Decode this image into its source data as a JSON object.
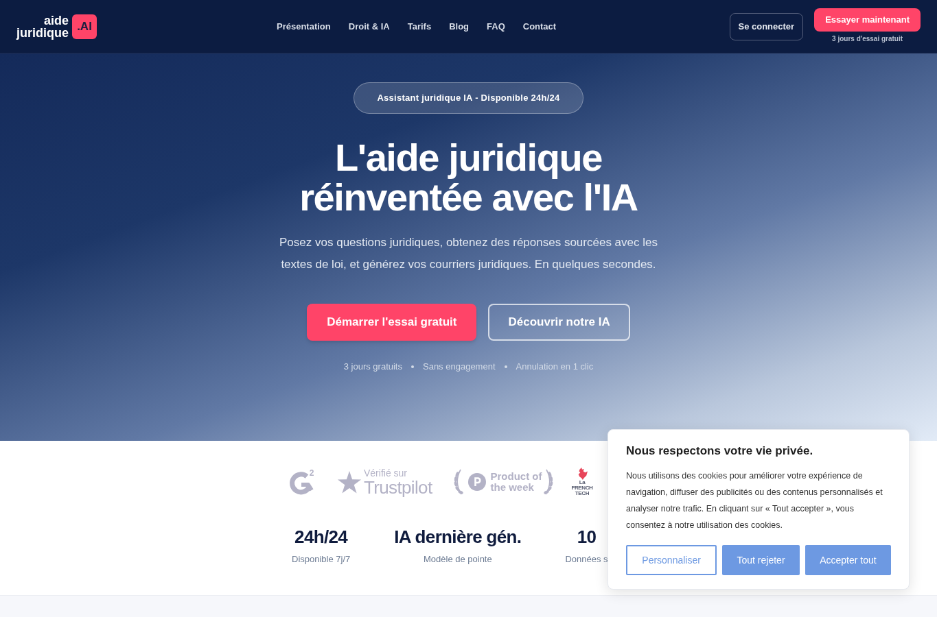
{
  "header": {
    "logo": {
      "line_1": "aide",
      "line_2": "juridique",
      "tile": ".AI"
    },
    "nav": [
      "Présentation",
      "Droit & IA",
      "Tarifs",
      "Blog",
      "FAQ",
      "Contact"
    ],
    "login_button": "Se connecter",
    "cta_button": "Essayer maintenant",
    "cta_note": "3 jours d'essai gratuit"
  },
  "hero": {
    "badge": "Assistant juridique IA - Disponible 24h/24",
    "title_lines": [
      "L'aide juridique",
      "réinventée avec l'IA"
    ],
    "subtitle": "Posez vos questions juridiques, obtenez des réponses sourcées avec les textes de loi, et générez vos courriers juridiques. En quelques secondes.",
    "buttons": [
      {
        "label": "Démarrer l'essai gratuit",
        "kind": "primary"
      },
      {
        "label": "Découvrir notre IA",
        "kind": "outline"
      }
    ],
    "perks": [
      "3 jours gratuits",
      "Sans engagement",
      "Annulation en 1 clic"
    ]
  },
  "trust_logos": [
    {
      "kind": "g2",
      "lines": [
        "2"
      ]
    },
    {
      "kind": "trustpilot",
      "lines": [
        "Vérifié sur",
        "Trustpilot"
      ]
    },
    {
      "kind": "award",
      "lines": [
        "Product of",
        "the week"
      ]
    },
    {
      "kind": "french_tech",
      "lines": [
        "La",
        "FRENCH",
        "TECH"
      ]
    }
  ],
  "stats": [
    {
      "value": "24h/24",
      "label": "Disponible 7j/7"
    },
    {
      "value": "IA dernière gén.",
      "label": "Modèle de pointe"
    },
    {
      "value": "10",
      "label": "Données s"
    }
  ],
  "cookie_banner": {
    "title": "Nous respectons votre vie privée.",
    "text": "Nous utilisons des cookies pour améliorer votre expérience de navigation, diffuser des publicités ou des contenus personnalisés et analyser notre trafic. En cliquant sur « Tout accepter », vous consentez à notre utilisation des cookies.",
    "buttons": [
      {
        "label": "Personnaliser",
        "kind": "outline"
      },
      {
        "label": "Tout rejeter",
        "kind": "filled"
      },
      {
        "label": "Accepter tout",
        "kind": "filled"
      }
    ]
  }
}
